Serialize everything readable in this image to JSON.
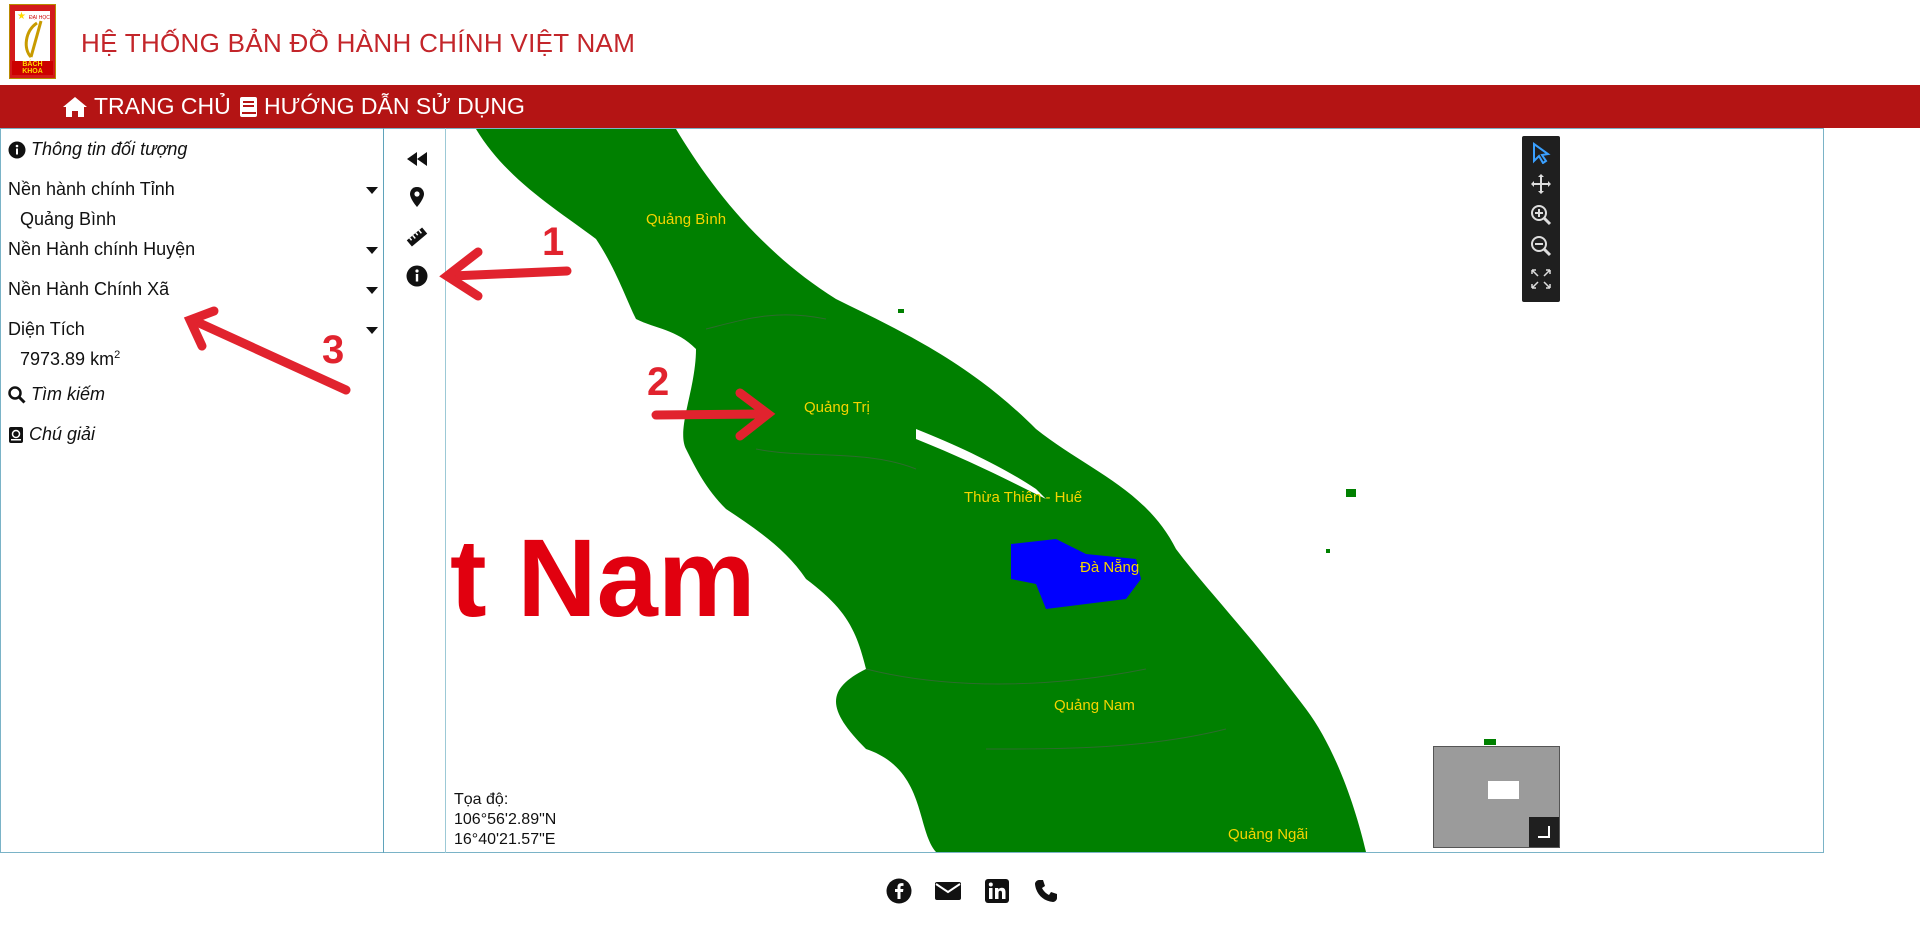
{
  "header": {
    "title": "HỆ THỐNG BẢN ĐỒ HÀNH CHÍNH VIỆT NAM",
    "logo_top": "ĐẠI HỌC",
    "logo_bottom": "BÁCH KHOA"
  },
  "nav": {
    "home": "TRANG CHỦ",
    "guide": "HƯỚNG DẪN SỬ DỤNG"
  },
  "sidebar": {
    "object_info": "Thông tin đối tượng",
    "province_layer": "Nền hành chính Tỉnh",
    "province_value": "Quảng Bình",
    "district_layer": "Nền Hành chính Huyện",
    "commune_layer": "Nền Hành Chính Xã",
    "area_label": "Diện Tích",
    "area_value": "7973.89 km",
    "area_unit_sup": "2",
    "search": "Tìm kiếm",
    "legend": "Chú giải"
  },
  "map": {
    "labels": {
      "quang_binh": "Quảng Bình",
      "quang_tri": "Quảng Trị",
      "thua_thien_hue": "Thừa Thiên - Huế",
      "da_nang": "Đà Nẵng",
      "quang_nam": "Quảng Nam",
      "quang_ngai": "Quảng Ngãi"
    },
    "big_text": "t Nam",
    "coord_label": "Tọa độ:",
    "coord_lat": "106°56'2.89\"N",
    "coord_lon": "16°40'21.57\"E",
    "colors": {
      "land": "#008000",
      "highlight": "#0000ff",
      "label": "#f5d400"
    }
  },
  "annotations": {
    "one": "1",
    "two": "2",
    "three": "3"
  },
  "colors": {
    "navbar": "#b41414",
    "title": "#c3252a",
    "annotation": "#e1232e"
  },
  "icons": [
    "home-icon",
    "book-icon",
    "info-icon",
    "caret-down-icon",
    "search-icon",
    "legend-icon",
    "rewind-icon",
    "map-pin-icon",
    "ruler-icon",
    "pointer-icon",
    "pan-icon",
    "zoom-in-icon",
    "zoom-out-icon",
    "fullscreen-icon",
    "facebook-icon",
    "mail-icon",
    "linkedin-icon",
    "phone-icon"
  ]
}
